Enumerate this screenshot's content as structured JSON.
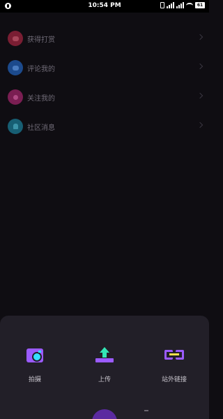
{
  "status_bar": {
    "time": "10:54 PM",
    "battery": "61"
  },
  "notifications": {
    "items": [
      {
        "label": "获得打赏",
        "icon": "gift-icon",
        "color": "#7a1e33"
      },
      {
        "label": "评论我的",
        "icon": "comment-icon",
        "color": "#1c4a8c"
      },
      {
        "label": "关注我的",
        "icon": "follow-icon",
        "color": "#7a1e52"
      },
      {
        "label": "社区消息",
        "icon": "bell-icon",
        "color": "#175e73"
      }
    ]
  },
  "action_sheet": {
    "shoot_label": "拍摄",
    "upload_label": "上传",
    "external_link_label": "站外链接"
  },
  "colors": {
    "background": "#0f0d12",
    "sheet": "#221f28",
    "accent_purple": "#9b5bff",
    "accent_cyan": "#35e0ff",
    "accent_green": "#33e6b5",
    "accent_yellow": "#f2e04a"
  }
}
